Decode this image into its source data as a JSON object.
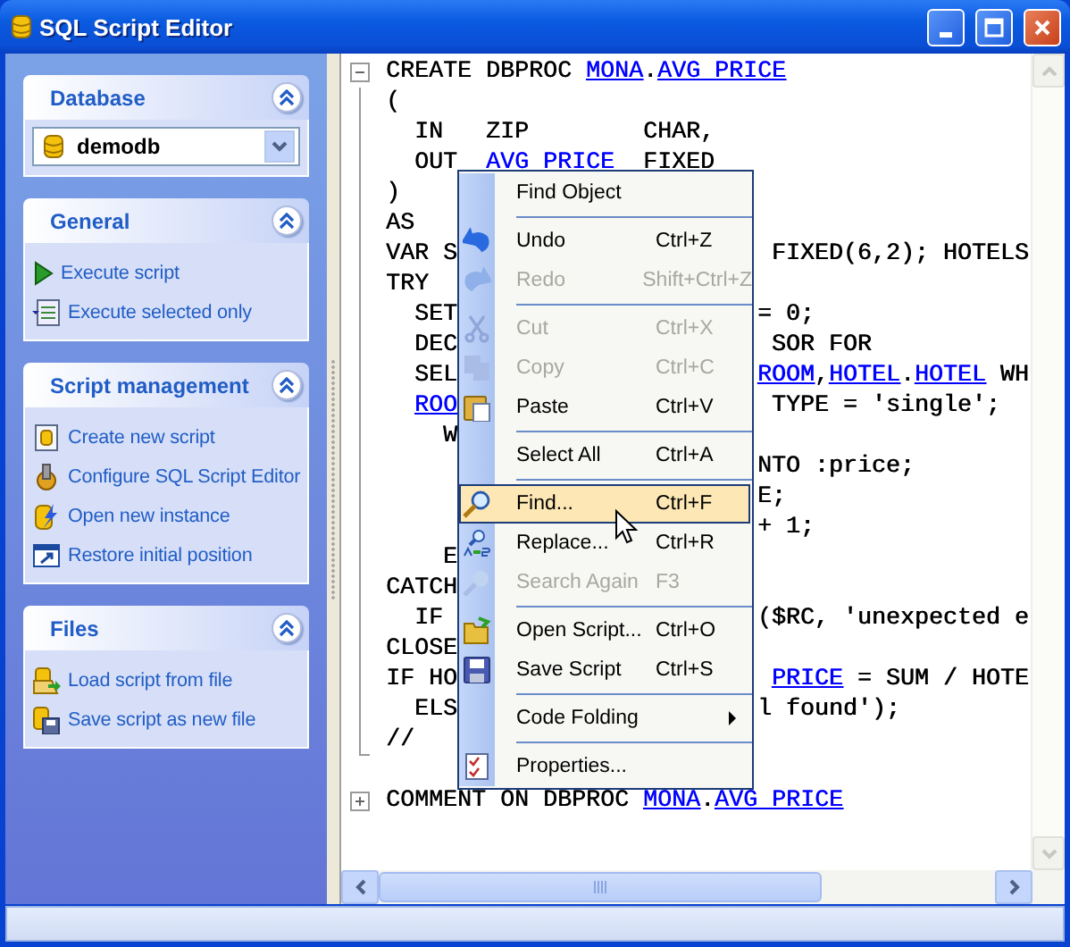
{
  "window": {
    "title": "SQL Script Editor"
  },
  "sidebar": {
    "panels": [
      {
        "title": "Database",
        "expanded": true,
        "kind": "select",
        "select": {
          "value": "demodb"
        }
      },
      {
        "title": "General",
        "expanded": true,
        "kind": "links",
        "items": [
          {
            "label": "Execute script"
          },
          {
            "label": "Execute selected only"
          }
        ]
      },
      {
        "title": "Script management",
        "expanded": true,
        "kind": "links",
        "items": [
          {
            "label": "Create new script"
          },
          {
            "label": "Configure SQL Script Editor"
          },
          {
            "label": "Open new instance"
          },
          {
            "label": "Restore initial position"
          }
        ]
      },
      {
        "title": "Files",
        "expanded": true,
        "kind": "links",
        "items": [
          {
            "label": "Load script from file"
          },
          {
            "label": "Save script as new file"
          }
        ]
      }
    ]
  },
  "editor": {
    "lines": [
      {
        "kind": "code",
        "folded": false,
        "left": [
          {
            "kind": "plain",
            "text": "CREATE DBPROC "
          },
          {
            "kind": "name",
            "text": "MONA"
          },
          {
            "kind": "plain",
            "text": "."
          },
          {
            "kind": "name",
            "text": "AVG PRICE"
          }
        ]
      },
      {
        "kind": "code",
        "left": [
          {
            "kind": "plain",
            "text": "("
          }
        ]
      },
      {
        "kind": "code",
        "left": [
          {
            "kind": "plain",
            "text": "  IN   ZIP        CHAR,"
          }
        ]
      },
      {
        "kind": "code",
        "left": [
          {
            "kind": "plain",
            "text": "  OUT  "
          },
          {
            "kind": "name",
            "text": "AVG PRICE"
          },
          {
            "kind": "plain",
            "text": "  FIXED"
          }
        ]
      },
      {
        "kind": "code",
        "left": [
          {
            "kind": "plain",
            "text": ")"
          }
        ]
      },
      {
        "kind": "code",
        "left": [
          {
            "kind": "plain",
            "text": "AS"
          }
        ]
      },
      {
        "kind": "code",
        "left": [
          {
            "kind": "plain",
            "text": "VAR S"
          }
        ],
        "right": [
          {
            "kind": "plain",
            "text": " FIXED(6,2); HOTELS"
          }
        ]
      },
      {
        "kind": "code",
        "left": [
          {
            "kind": "plain",
            "text": "TRY"
          }
        ]
      },
      {
        "kind": "code",
        "left": [
          {
            "kind": "plain",
            "text": "  SET"
          }
        ],
        "right": [
          {
            "kind": "plain",
            "text": "= 0;"
          }
        ]
      },
      {
        "kind": "code",
        "left": [
          {
            "kind": "plain",
            "text": "  DEC"
          }
        ],
        "right": [
          {
            "kind": "plain",
            "text": " SOR FOR"
          }
        ]
      },
      {
        "kind": "code",
        "left": [
          {
            "kind": "plain",
            "text": "  SEL"
          }
        ],
        "right": [
          {
            "kind": "name",
            "text": "ROOM"
          },
          {
            "kind": "plain",
            "text": ","
          },
          {
            "kind": "name",
            "text": "HOTEL"
          },
          {
            "kind": "plain",
            "text": "."
          },
          {
            "kind": "name",
            "text": "HOTEL"
          },
          {
            "kind": "plain",
            "text": " WH"
          }
        ]
      },
      {
        "kind": "code",
        "left": [
          {
            "kind": "name",
            "text": "  ROO"
          }
        ],
        "right": [
          {
            "kind": "plain",
            "text": " TYPE = 'single';"
          }
        ]
      },
      {
        "kind": "code",
        "left": [
          {
            "kind": "plain",
            "text": "    W"
          }
        ]
      },
      {
        "kind": "code",
        "right": [
          {
            "kind": "plain",
            "text": "NTO :price;"
          }
        ]
      },
      {
        "kind": "code",
        "right": [
          {
            "kind": "plain",
            "text": "E;"
          }
        ]
      },
      {
        "kind": "code",
        "right": [
          {
            "kind": "plain",
            "text": "+ 1;"
          }
        ]
      },
      {
        "kind": "code",
        "left": [
          {
            "kind": "plain",
            "text": "    E"
          }
        ]
      },
      {
        "kind": "code",
        "left": [
          {
            "kind": "plain",
            "text": "CATCH"
          }
        ]
      },
      {
        "kind": "code",
        "left": [
          {
            "kind": "plain",
            "text": "  IF"
          }
        ],
        "right": [
          {
            "kind": "plain",
            "text": "($RC, 'unexpected e"
          }
        ]
      },
      {
        "kind": "code",
        "left": [
          {
            "kind": "plain",
            "text": "CLOSE"
          }
        ]
      },
      {
        "kind": "code",
        "left": [
          {
            "kind": "plain",
            "text": "IF HO"
          }
        ],
        "right": [
          {
            "kind": "name",
            "text": " PRICE"
          },
          {
            "kind": "plain",
            "text": " = SUM / HOTE"
          }
        ]
      },
      {
        "kind": "code",
        "left": [
          {
            "kind": "plain",
            "text": "  ELS"
          }
        ],
        "right": [
          {
            "kind": "plain",
            "text": "l found');"
          }
        ]
      },
      {
        "kind": "code",
        "left": [
          {
            "kind": "plain",
            "text": "//"
          }
        ]
      },
      {
        "kind": "blank"
      },
      {
        "kind": "code",
        "folded": true,
        "left": [
          {
            "kind": "plain",
            "text": "COMMENT ON DBPROC "
          },
          {
            "kind": "name",
            "text": "MONA"
          },
          {
            "kind": "plain",
            "text": "."
          },
          {
            "kind": "name",
            "text": "AVG PRICE"
          }
        ]
      }
    ]
  },
  "context_menu": {
    "items": [
      {
        "kind": "item",
        "label": "Find Object",
        "disabled": false,
        "selected": false
      },
      {
        "kind": "separator"
      },
      {
        "kind": "item",
        "label": "Undo",
        "shortcut": "Ctrl+Z",
        "disabled": false,
        "selected": false
      },
      {
        "kind": "item",
        "label": "Redo",
        "shortcut": "Shift+Ctrl+Z",
        "disabled": true,
        "selected": false
      },
      {
        "kind": "separator"
      },
      {
        "kind": "item",
        "label": "Cut",
        "shortcut": "Ctrl+X",
        "disabled": true,
        "selected": false
      },
      {
        "kind": "item",
        "label": "Copy",
        "shortcut": "Ctrl+C",
        "disabled": true,
        "selected": false
      },
      {
        "kind": "item",
        "label": "Paste",
        "shortcut": "Ctrl+V",
        "disabled": false,
        "selected": false
      },
      {
        "kind": "separator"
      },
      {
        "kind": "item",
        "label": "Select All",
        "shortcut": "Ctrl+A",
        "disabled": false,
        "selected": false
      },
      {
        "kind": "separator"
      },
      {
        "kind": "item",
        "label": "Find...",
        "shortcut": "Ctrl+F",
        "disabled": false,
        "selected": true
      },
      {
        "kind": "item",
        "label": "Replace...",
        "shortcut": "Ctrl+R",
        "disabled": false,
        "selected": false
      },
      {
        "kind": "item",
        "label": "Search Again",
        "shortcut": "F3",
        "disabled": true,
        "selected": false
      },
      {
        "kind": "separator"
      },
      {
        "kind": "item",
        "label": "Open Script...",
        "shortcut": "Ctrl+O",
        "disabled": false,
        "selected": false
      },
      {
        "kind": "item",
        "label": "Save Script",
        "shortcut": "Ctrl+S",
        "disabled": false,
        "selected": false
      },
      {
        "kind": "separator"
      },
      {
        "kind": "submenu",
        "label": "Code Folding",
        "disabled": false,
        "selected": false
      },
      {
        "kind": "separator"
      },
      {
        "kind": "item",
        "label": "Properties...",
        "disabled": false,
        "selected": false
      }
    ]
  }
}
